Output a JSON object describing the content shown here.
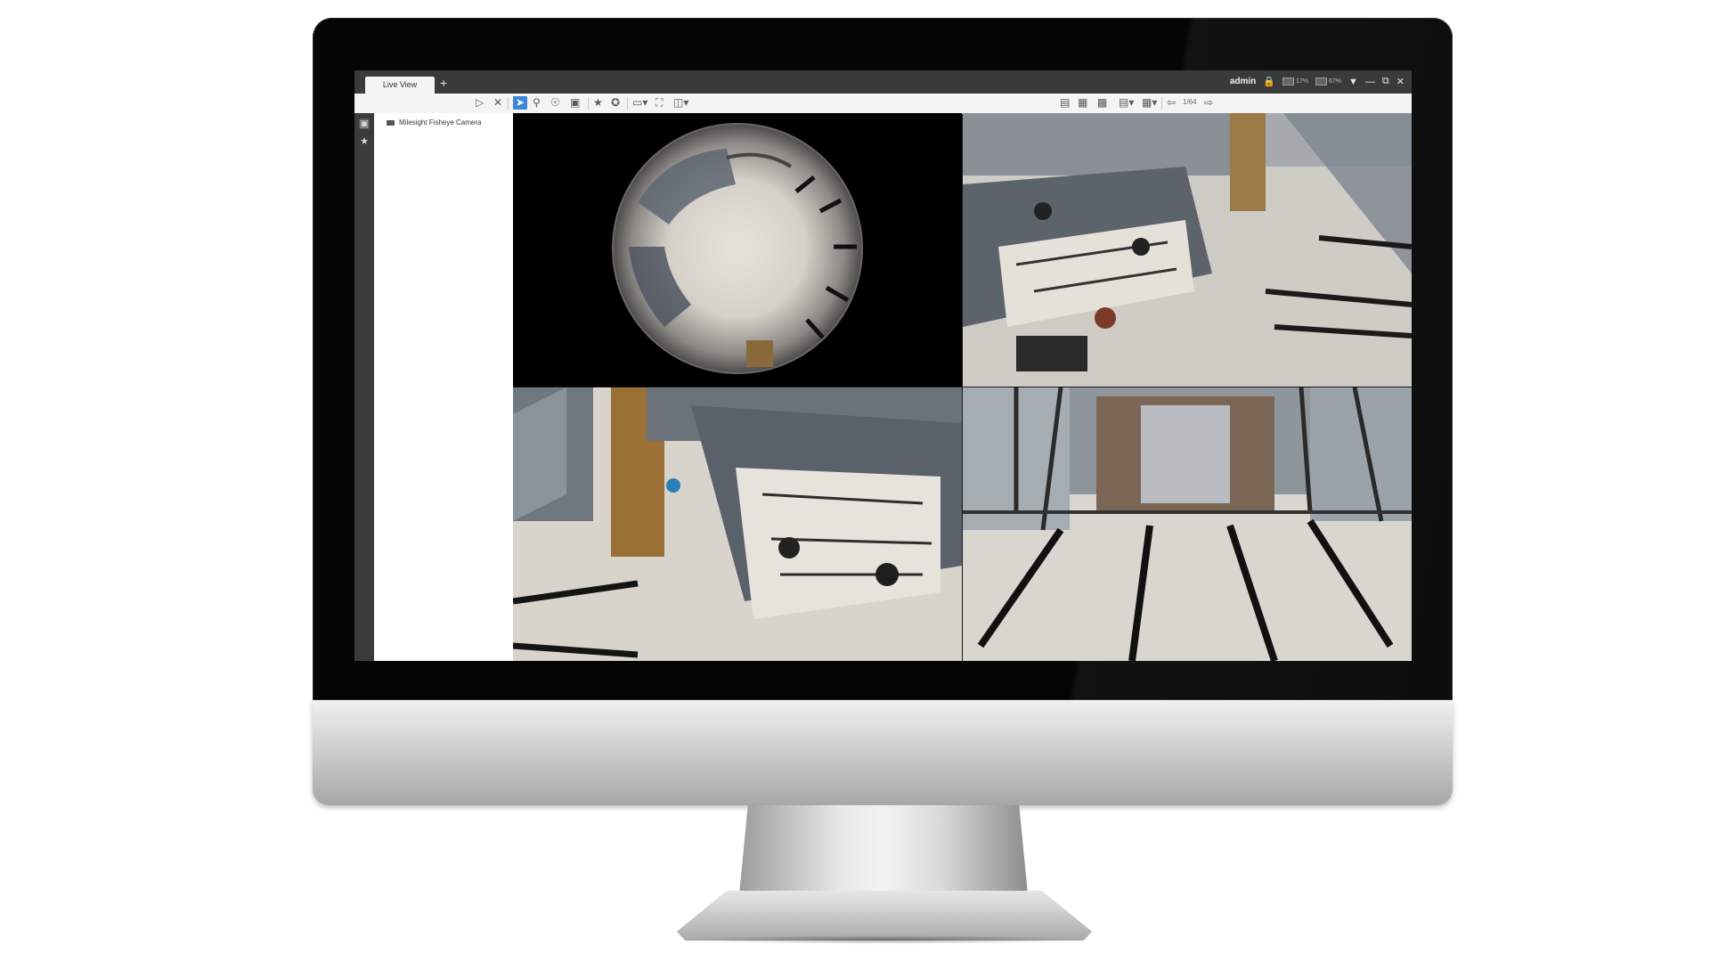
{
  "app": {
    "tabs": [
      {
        "label": "Live View"
      }
    ],
    "add_tab": "+",
    "user": "admin",
    "cpu": "17%",
    "ram": "67%"
  },
  "toolbar": {
    "page_indicator": "1/64"
  },
  "sidebar": {
    "devices": [
      {
        "label": "Milesight Fisheye Camera"
      }
    ]
  },
  "colors": {
    "titlebar": "#3a3a3a",
    "toolbar": "#f4f4f4",
    "selected_tool": "#3f86d9",
    "rail": "#3b3b3b"
  },
  "icons": {
    "window": [
      "filter-icon",
      "minimize-icon",
      "restore-icon",
      "close-icon"
    ],
    "tools": [
      "play-icon",
      "close-all-icon",
      "select-icon",
      "zoom-icon",
      "ptz-icon",
      "snapshot-icon",
      "favorite-icon",
      "add-favorite-icon",
      "layout-icon",
      "fullscreen-icon",
      "window-division-icon"
    ]
  }
}
